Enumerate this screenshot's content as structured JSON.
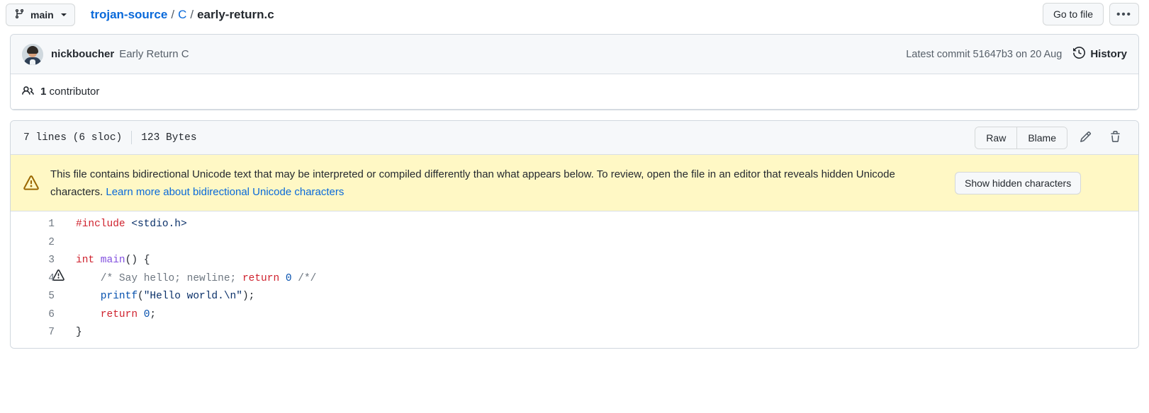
{
  "header": {
    "branch": "main",
    "branch_icon": "git-branch-icon",
    "caret_icon": "chevron-down-icon",
    "breadcrumb": {
      "repo": "trojan-source",
      "sep": "/",
      "folder": "C",
      "file": "early-return.c"
    },
    "go_to_file_label": "Go to file",
    "kebab_label": "•••"
  },
  "commit": {
    "avatar_name": "nickboucher-avatar",
    "author": "nickboucher",
    "message": "Early Return C",
    "latest_commit": "Latest commit 51647b3 on 20 Aug",
    "history_label": "History",
    "history_icon": "history-clock-icon"
  },
  "contributors": {
    "icon": "people-icon",
    "count": "1",
    "label": "contributor"
  },
  "blob": {
    "lines": "7 lines (6 sloc)",
    "size": "123 Bytes",
    "raw_label": "Raw",
    "blame_label": "Blame",
    "edit_icon": "pencil-icon",
    "delete_icon": "trash-icon"
  },
  "warning": {
    "icon": "alert-triangle-icon",
    "text_part1": "This file contains bidirectional Unicode text that may be interpreted or compiled differently than what appears below. To review, open the file in an editor that reveals hidden Unicode characters. ",
    "link_text": "Learn more about bidirectional Unicode characters",
    "button_label": "Show hidden characters",
    "bg_color": "#fff8c5"
  },
  "code": {
    "line1_num": "1",
    "line1_include": "#include",
    "line1_header": " <stdio.h>",
    "line2_num": "2",
    "line3_num": "3",
    "line3_int": "int",
    "line3_main": " main",
    "line3_rest": "() {",
    "line4_num": "4",
    "line4_warn_icon": "alert-triangle-icon",
    "line4_comment": "    /* Say hello; newline; ",
    "line4_return": "return",
    "line4_zero": " 0",
    "line4_tail": " /*/",
    "line5_num": "5",
    "line5_printf": "    printf",
    "line5_open": "(",
    "line5_str": "\"Hello world.\\n\"",
    "line5_close": ");",
    "line6_num": "6",
    "line6_return": "    return",
    "line6_zero": " 0",
    "line6_semi": ";",
    "line7_num": "7",
    "line7_brace": "}"
  }
}
